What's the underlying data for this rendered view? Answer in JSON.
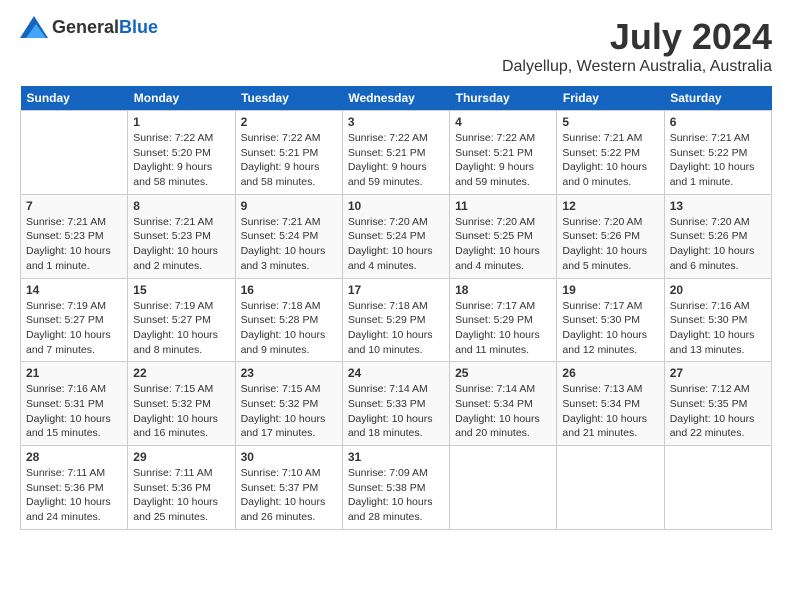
{
  "header": {
    "logo_general": "General",
    "logo_blue": "Blue",
    "title": "July 2024",
    "subtitle": "Dalyellup, Western Australia, Australia"
  },
  "calendar": {
    "days_of_week": [
      "Sunday",
      "Monday",
      "Tuesday",
      "Wednesday",
      "Thursday",
      "Friday",
      "Saturday"
    ],
    "weeks": [
      [
        {
          "day": "",
          "info": ""
        },
        {
          "day": "1",
          "info": "Sunrise: 7:22 AM\nSunset: 5:20 PM\nDaylight: 9 hours\nand 58 minutes."
        },
        {
          "day": "2",
          "info": "Sunrise: 7:22 AM\nSunset: 5:21 PM\nDaylight: 9 hours\nand 58 minutes."
        },
        {
          "day": "3",
          "info": "Sunrise: 7:22 AM\nSunset: 5:21 PM\nDaylight: 9 hours\nand 59 minutes."
        },
        {
          "day": "4",
          "info": "Sunrise: 7:22 AM\nSunset: 5:21 PM\nDaylight: 9 hours\nand 59 minutes."
        },
        {
          "day": "5",
          "info": "Sunrise: 7:21 AM\nSunset: 5:22 PM\nDaylight: 10 hours\nand 0 minutes."
        },
        {
          "day": "6",
          "info": "Sunrise: 7:21 AM\nSunset: 5:22 PM\nDaylight: 10 hours\nand 1 minute."
        }
      ],
      [
        {
          "day": "7",
          "info": "Sunrise: 7:21 AM\nSunset: 5:23 PM\nDaylight: 10 hours\nand 1 minute."
        },
        {
          "day": "8",
          "info": "Sunrise: 7:21 AM\nSunset: 5:23 PM\nDaylight: 10 hours\nand 2 minutes."
        },
        {
          "day": "9",
          "info": "Sunrise: 7:21 AM\nSunset: 5:24 PM\nDaylight: 10 hours\nand 3 minutes."
        },
        {
          "day": "10",
          "info": "Sunrise: 7:20 AM\nSunset: 5:24 PM\nDaylight: 10 hours\nand 4 minutes."
        },
        {
          "day": "11",
          "info": "Sunrise: 7:20 AM\nSunset: 5:25 PM\nDaylight: 10 hours\nand 4 minutes."
        },
        {
          "day": "12",
          "info": "Sunrise: 7:20 AM\nSunset: 5:26 PM\nDaylight: 10 hours\nand 5 minutes."
        },
        {
          "day": "13",
          "info": "Sunrise: 7:20 AM\nSunset: 5:26 PM\nDaylight: 10 hours\nand 6 minutes."
        }
      ],
      [
        {
          "day": "14",
          "info": "Sunrise: 7:19 AM\nSunset: 5:27 PM\nDaylight: 10 hours\nand 7 minutes."
        },
        {
          "day": "15",
          "info": "Sunrise: 7:19 AM\nSunset: 5:27 PM\nDaylight: 10 hours\nand 8 minutes."
        },
        {
          "day": "16",
          "info": "Sunrise: 7:18 AM\nSunset: 5:28 PM\nDaylight: 10 hours\nand 9 minutes."
        },
        {
          "day": "17",
          "info": "Sunrise: 7:18 AM\nSunset: 5:29 PM\nDaylight: 10 hours\nand 10 minutes."
        },
        {
          "day": "18",
          "info": "Sunrise: 7:17 AM\nSunset: 5:29 PM\nDaylight: 10 hours\nand 11 minutes."
        },
        {
          "day": "19",
          "info": "Sunrise: 7:17 AM\nSunset: 5:30 PM\nDaylight: 10 hours\nand 12 minutes."
        },
        {
          "day": "20",
          "info": "Sunrise: 7:16 AM\nSunset: 5:30 PM\nDaylight: 10 hours\nand 13 minutes."
        }
      ],
      [
        {
          "day": "21",
          "info": "Sunrise: 7:16 AM\nSunset: 5:31 PM\nDaylight: 10 hours\nand 15 minutes."
        },
        {
          "day": "22",
          "info": "Sunrise: 7:15 AM\nSunset: 5:32 PM\nDaylight: 10 hours\nand 16 minutes."
        },
        {
          "day": "23",
          "info": "Sunrise: 7:15 AM\nSunset: 5:32 PM\nDaylight: 10 hours\nand 17 minutes."
        },
        {
          "day": "24",
          "info": "Sunrise: 7:14 AM\nSunset: 5:33 PM\nDaylight: 10 hours\nand 18 minutes."
        },
        {
          "day": "25",
          "info": "Sunrise: 7:14 AM\nSunset: 5:34 PM\nDaylight: 10 hours\nand 20 minutes."
        },
        {
          "day": "26",
          "info": "Sunrise: 7:13 AM\nSunset: 5:34 PM\nDaylight: 10 hours\nand 21 minutes."
        },
        {
          "day": "27",
          "info": "Sunrise: 7:12 AM\nSunset: 5:35 PM\nDaylight: 10 hours\nand 22 minutes."
        }
      ],
      [
        {
          "day": "28",
          "info": "Sunrise: 7:11 AM\nSunset: 5:36 PM\nDaylight: 10 hours\nand 24 minutes."
        },
        {
          "day": "29",
          "info": "Sunrise: 7:11 AM\nSunset: 5:36 PM\nDaylight: 10 hours\nand 25 minutes."
        },
        {
          "day": "30",
          "info": "Sunrise: 7:10 AM\nSunset: 5:37 PM\nDaylight: 10 hours\nand 26 minutes."
        },
        {
          "day": "31",
          "info": "Sunrise: 7:09 AM\nSunset: 5:38 PM\nDaylight: 10 hours\nand 28 minutes."
        },
        {
          "day": "",
          "info": ""
        },
        {
          "day": "",
          "info": ""
        },
        {
          "day": "",
          "info": ""
        }
      ]
    ]
  }
}
